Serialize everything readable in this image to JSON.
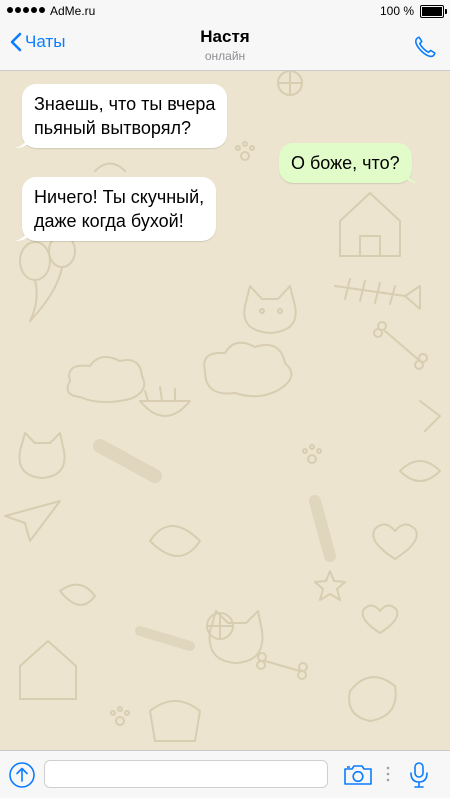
{
  "status_bar": {
    "carrier": "AdMe.ru",
    "battery_percent": "100 %",
    "battery_level": 1.0
  },
  "nav": {
    "back_label": "Чаты",
    "contact_name": "Настя",
    "contact_status": "онлайн",
    "icons": {
      "back": "chevron-left-icon",
      "call": "phone-icon"
    }
  },
  "chat": {
    "messages": [
      {
        "direction": "incoming",
        "lines": [
          "Знаешь, что ты вчера",
          "пьяный вытворял?"
        ]
      },
      {
        "direction": "outgoing",
        "lines": [
          "О боже, что?"
        ]
      },
      {
        "direction": "incoming",
        "lines": [
          "Ничего! Ты скучный,",
          "даже когда бухой!"
        ]
      }
    ]
  },
  "input_bar": {
    "placeholder": "",
    "icons": {
      "attach": "share-arrow-icon",
      "camera": "camera-icon",
      "mic": "microphone-icon"
    }
  },
  "colors": {
    "accent": "#0a7dff",
    "chat_background": "#ece4cf",
    "outgoing_bubble": "#e1fbc9",
    "incoming_bubble": "#ffffff"
  }
}
